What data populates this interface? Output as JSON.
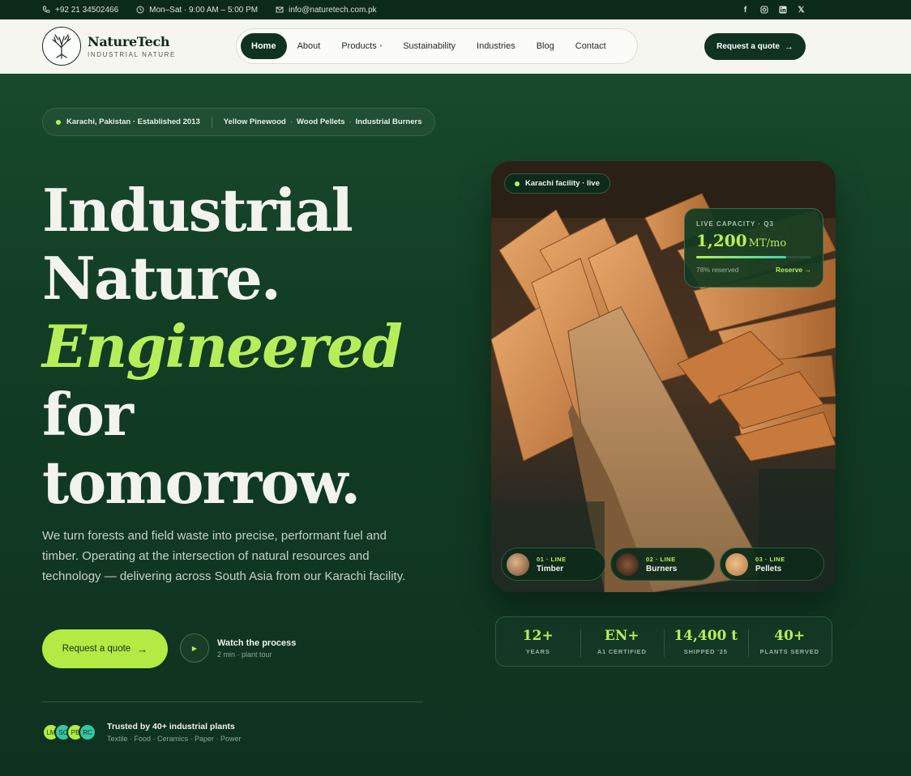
{
  "topbar": {
    "phone": "+92 21 34502466",
    "hours": "Mon–Sat · 9:00 AM – 5:00 PM",
    "email": "info@naturetech.com.pk",
    "social": [
      "facebook-icon",
      "instagram-icon",
      "linkedin-icon",
      "x-icon"
    ]
  },
  "brand": {
    "name": "NatureTech",
    "tagline": "INDUSTRIAL NATURE"
  },
  "nav": {
    "items": [
      {
        "label": "Home",
        "active": true
      },
      {
        "label": "About"
      },
      {
        "label": "Products",
        "has_dropdown": true
      },
      {
        "label": "Sustainability"
      },
      {
        "label": "Industries"
      },
      {
        "label": "Blog"
      },
      {
        "label": "Contact"
      }
    ],
    "cta": "Request a quote"
  },
  "hero": {
    "pill": {
      "location": "Karachi, Pakistan · Established 2013",
      "products": [
        "Yellow Pinewood",
        "Wood Pellets",
        "Industrial Burners"
      ]
    },
    "headline": {
      "line1": "Industrial",
      "line2": "Nature.",
      "line3": "Engineered",
      "line4": "for",
      "line5": "tomorrow."
    },
    "lede": "We turn forests and field waste into precise, performant fuel and timber. Operating at the intersection of natural resources and technology — delivering across South Asia from our Karachi facility.",
    "primary_cta": "Request a quote",
    "watch": {
      "title": "Watch the process",
      "subtitle": "2 min · plant tour"
    },
    "trust": {
      "avatars": [
        {
          "initials": "LM",
          "color": "#b3ea43"
        },
        {
          "initials": "SC",
          "color": "#35c7a3"
        },
        {
          "initials": "PB",
          "color": "#b3ea43"
        },
        {
          "initials": "RC",
          "color": "#35c7a3"
        }
      ],
      "title": "Trusted by 40+ industrial plants",
      "industries": "Textile · Food · Ceramics · Paper · Power"
    }
  },
  "media": {
    "live_label": "Karachi facility · live",
    "capacity": {
      "label": "LIVE CAPACITY · Q3",
      "value": "1,200",
      "unit": "MT/mo",
      "reserved_pct": 78,
      "reserved_text": "78% reserved",
      "link": "Reserve"
    },
    "lines": [
      {
        "tag": "01 · LINE",
        "name": "Timber"
      },
      {
        "tag": "02 · LINE",
        "name": "Burners"
      },
      {
        "tag": "03 · LINE",
        "name": "Pellets"
      }
    ]
  },
  "stats": [
    {
      "value": "12+",
      "label": "YEARS"
    },
    {
      "value": "EN+",
      "label": "A1 CERTIFIED"
    },
    {
      "value": "14,400 t",
      "label": "SHIPPED '25"
    },
    {
      "value": "40+",
      "label": "PLANTS SERVED"
    }
  ],
  "colors": {
    "accent": "#b6ee5b",
    "dark_green": "#0f3320",
    "header_bg": "#f6f6f1"
  }
}
